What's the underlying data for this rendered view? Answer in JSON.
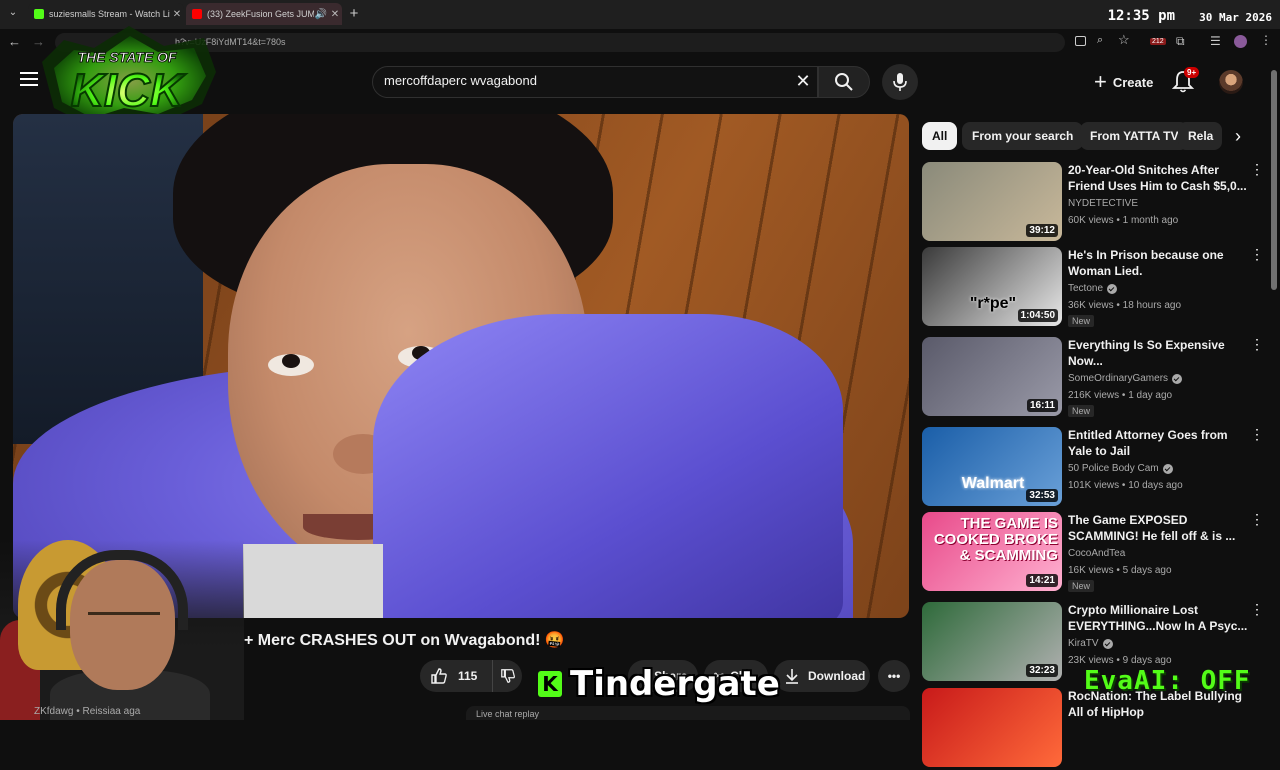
{
  "browser": {
    "tabs": [
      {
        "label": "suziesmalls Stream - Watch Live",
        "favicon_color": "#53fc18"
      },
      {
        "label": "(33) ZeekFusion Gets JUMP",
        "favicon_color": "#ff0000"
      }
    ],
    "new_tab_label": "+",
    "url": "h?v=UzF8iYdMT14&t=780s",
    "clock": "12:35 pm",
    "date": "30 Mar 2026",
    "ext_count": "212"
  },
  "overlay": {
    "logo_line1": "THE STATE OF",
    "logo_line2": "KICK",
    "tindergate": "Tindergate",
    "tindergate_k": "K",
    "evaai": "EvaAI: OFF"
  },
  "header": {
    "search_value": "mercoffdaperc wvagabond",
    "create_label": "Create",
    "notif_badge": "9+"
  },
  "video": {
    "title": "+ Merc CRASHES OUT on Wvagabond! 🤬",
    "likes": "115",
    "share_label": "Share",
    "clip_label": "Clip",
    "download_label": "Download",
    "channel_strip": "ZKfdawg • Reissiaa aga",
    "livechat_label": "Live chat replay"
  },
  "chips": [
    "All",
    "From your search",
    "From YATTA TV",
    "Rela"
  ],
  "recommendations": [
    {
      "title": "20-Year-Old Snitches After Friend Uses Him to Cash $5,0...",
      "channel": "NYDETECTIVE",
      "verified": false,
      "meta": "60K views • 1 month ago",
      "duration": "39:12",
      "new": "",
      "colors": [
        "#8a8a7a",
        "#c8b89a"
      ]
    },
    {
      "title": "He's In Prison because one Woman Lied.",
      "channel": "Tectone",
      "verified": true,
      "meta": "36K views • 18 hours ago",
      "duration": "1:04:50",
      "new": "New",
      "thumb_text": "\"r*pe\"",
      "colors": [
        "#3a3a3a",
        "#e8e8e8"
      ]
    },
    {
      "title": "Everything Is So Expensive Now...",
      "channel": "SomeOrdinaryGamers",
      "verified": true,
      "meta": "216K views • 1 day ago",
      "duration": "16:11",
      "new": "New",
      "colors": [
        "#5a5a6a",
        "#9a9aa8"
      ]
    },
    {
      "title": "Entitled Attorney Goes from Yale to Jail",
      "channel": "50 Police Body Cam",
      "verified": true,
      "meta": "101K views • 10 days ago",
      "duration": "32:53",
      "new": "",
      "thumb_text": "Walmart",
      "colors": [
        "#1a5ea8",
        "#6aa0d8"
      ]
    },
    {
      "title": "The Game EXPOSED SCAMMING! He fell off & is ...",
      "channel": "CocoAndTea",
      "verified": false,
      "meta": "16K views • 5 days ago",
      "duration": "14:21",
      "new": "New",
      "thumb_text": "THE GAME IS COOKED BROKE & SCAMMING",
      "colors": [
        "#e84a8a",
        "#ffb0d0"
      ]
    },
    {
      "title": "Crypto Millionaire Lost EVERYTHING...Now In A Psyc...",
      "channel": "KiraTV",
      "verified": true,
      "meta": "23K views • 9 days ago",
      "duration": "32:23",
      "new": "",
      "colors": [
        "#2e6a3a",
        "#b0b0b0"
      ]
    },
    {
      "title": "RocNation: The Label Bullying All of HipHop",
      "channel": "",
      "verified": false,
      "meta": "",
      "duration": "",
      "new": "",
      "colors": [
        "#c81a1a",
        "#ff6a3a"
      ]
    }
  ]
}
